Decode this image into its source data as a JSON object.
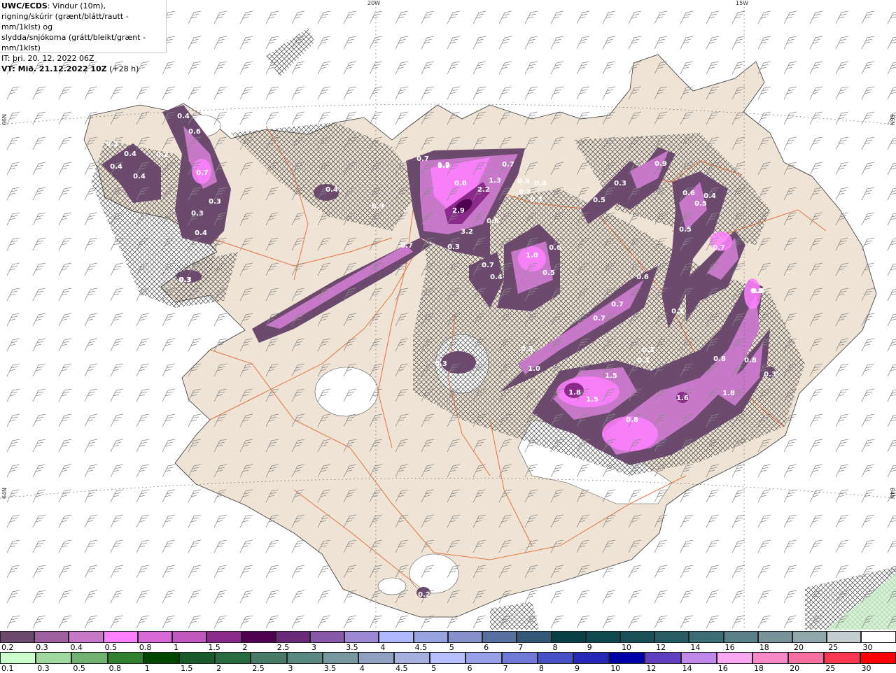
{
  "info": {
    "model": "UWC/ECDS",
    "line1_rest": ": Vindur (10m),",
    "line2": "rigning/skúrir (grænt/blátt/rautt - mm/1klst) og",
    "line3": "slydda/snjókoma (grátt/bleikt/grænt - mm/1klst)",
    "it": "IT: þri. 20. 12. 2022 06Z",
    "vt_bold": "VT: Mið. 21.12.2022 10Z",
    "vt_rest": " (+28 h)"
  },
  "axes": {
    "lon_20": "20W",
    "lon_15": "15W",
    "lat_66_left": "66N",
    "lat_64_left": "64N",
    "lat_66_right": "66N",
    "lat_64_right": "64N"
  },
  "colors": {
    "land": "#efe3d5",
    "roads": "#e0622a",
    "barbs": "#777777"
  },
  "precip_labels": [
    "0.4",
    "0.6",
    "0.2",
    "0.4",
    "0.4",
    "0.4",
    "0.2",
    "0.7",
    "0.3",
    "0.3",
    "0.4",
    "0.3",
    "0.4",
    "0.7",
    "0.9",
    "0.7",
    "0.7",
    "1.2",
    "0.8",
    "1.3",
    "2.2",
    "2.9",
    "3.2",
    "0.6",
    "0.9",
    "0.7",
    "0.3",
    "0.4",
    "0.3",
    "0.3",
    "0.7",
    "0.4",
    "1.0",
    "0.6",
    "0.5",
    "0.5",
    "0.3",
    "0.9",
    "0.6",
    "0.4",
    "0.5",
    "0.5",
    "0.7",
    "0.6",
    "0.8",
    "0.7",
    "0.7",
    "0.3",
    "0.3",
    "0.8",
    "0.3",
    "0.3",
    "1.0",
    "0.3",
    "1.5",
    "1.8",
    "1.5",
    "0.8",
    "1.6",
    "0.8",
    "0.8",
    "1.8",
    "0.3",
    "0.2",
    "0.3"
  ],
  "legend_snow": {
    "labels": [
      "0.2",
      "0.3",
      "0.4",
      "0.5",
      "0.8",
      "1",
      "1.5",
      "2",
      "2.5",
      "3",
      "3.5",
      "4",
      "4.5",
      "5",
      "6",
      "7",
      "8",
      "9",
      "10",
      "12",
      "14",
      "16",
      "18",
      "20",
      "25",
      "30"
    ],
    "colors": [
      "#6b4a6e",
      "#9e5f9e",
      "#c878c8",
      "#ff80ff",
      "#d868d8",
      "#c058c0",
      "#8a2a8a",
      "#500050",
      "#6a2a7a",
      "#8858a8",
      "#9c88d4",
      "#b0b8ff",
      "#98a4e0",
      "#8890cc",
      "#5870a0",
      "#345878",
      "#0a4048",
      "#104850",
      "#1a5058",
      "#285c64",
      "#3c6c74",
      "#5a8088",
      "#78949a",
      "#90a8ac",
      "#c4ced0",
      "#ffffff"
    ]
  },
  "legend_rain": {
    "labels": [
      "0.1",
      "0.3",
      "0.5",
      "0.8",
      "1",
      "1.5",
      "2",
      "2.5",
      "3",
      "3.5",
      "4",
      "4.5",
      "5",
      "6",
      "7",
      "8",
      "9",
      "10",
      "12",
      "14",
      "16",
      "18",
      "20",
      "25",
      "30"
    ],
    "colors": [
      "#ccffcc",
      "#a0d8a0",
      "#70b070",
      "#308030",
      "#004800",
      "#1a5a2a",
      "#2a6a40",
      "#4a7a68",
      "#5a8880",
      "#7898a0",
      "#90a0c0",
      "#a8b0e0",
      "#b8c0ff",
      "#98a0e8",
      "#7078d8",
      "#4850c8",
      "#2828b8",
      "#0000a8",
      "#6040c0",
      "#c088e8",
      "#f8a8f0",
      "#f888c8",
      "#f870a0",
      "#f83850",
      "#ff0000"
    ]
  }
}
